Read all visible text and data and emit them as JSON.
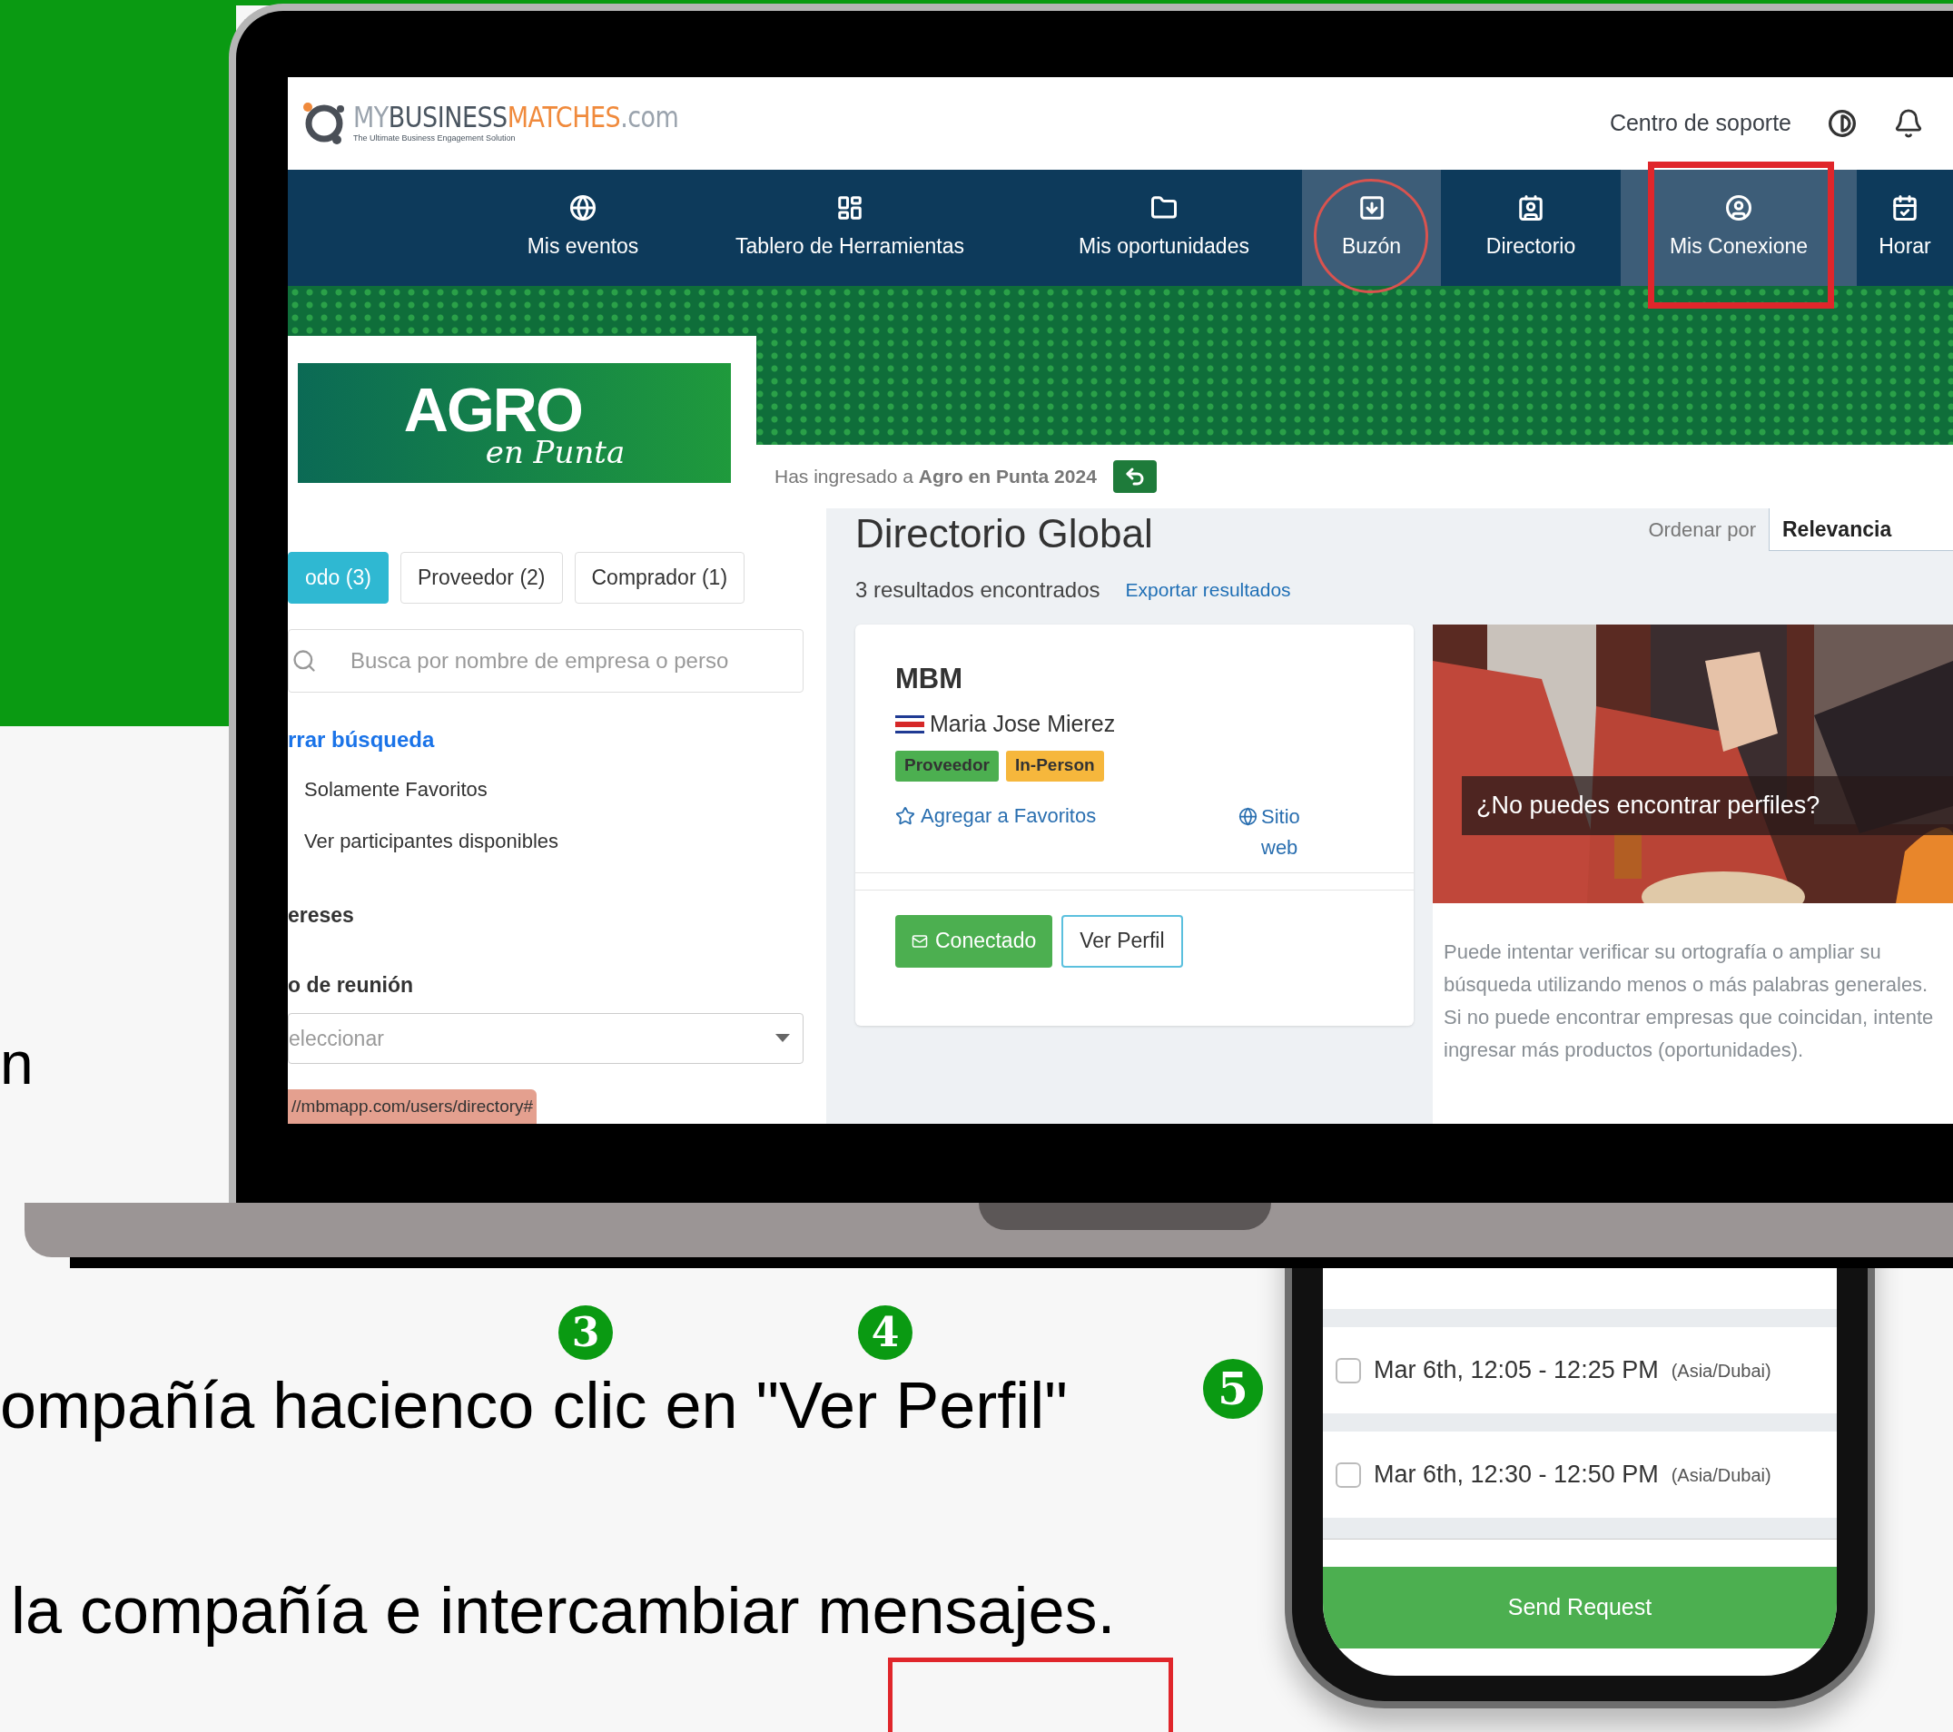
{
  "slide": {
    "fragment": "n",
    "steps": [
      {
        "number": "3"
      },
      {
        "number": "4"
      },
      {
        "number": "5"
      }
    ],
    "line_1": "ompañía hacienco clic en \"Ver Perfil\"",
    "line_2": "la compañía e intercambiar mensajes."
  },
  "app": {
    "logo": {
      "parts": [
        {
          "text": "MY",
          "color": "#9aa3ad"
        },
        {
          "text": "BUSINESS",
          "color": "#4a5560"
        },
        {
          "text": "MATCHES",
          "color": "#f08a3c"
        },
        {
          "text": ".com",
          "color": "#9aa3ad"
        }
      ],
      "tagline": "The Ultimate Business Engagement Solution"
    },
    "support_link": "Centro de soporte",
    "nav": [
      {
        "label": "Mis eventos",
        "highlighted": false
      },
      {
        "label": "Tablero de Herramientas",
        "highlighted": false
      },
      {
        "label": "Mis oportunidades",
        "highlighted": false
      },
      {
        "label": "Buzón",
        "highlighted": true
      },
      {
        "label": "Directorio",
        "highlighted": false
      },
      {
        "label": "Mis Conexione",
        "highlighted": true
      },
      {
        "label": "Horar",
        "highlighted": false
      }
    ],
    "event_logo": {
      "title": "AGRO",
      "subtitle": "en Punta"
    },
    "entered_notice": "Has ingresado a **Agro en Punta 2024**",
    "filters": {
      "tabs": [
        {
          "label": "odo (3)",
          "selected": true
        },
        {
          "label": "Proveedor (2)",
          "selected": false
        },
        {
          "label": "Comprador (1)",
          "selected": false
        }
      ],
      "search": {
        "placeholder": "Busca por nombre de empresa o perso"
      },
      "clear_link": "rrar búsqueda",
      "options": [
        "Solamente Favoritos",
        "Ver participantes disponibles"
      ],
      "section_1": "ereses",
      "section_2": "o de reunión",
      "select": {
        "placeholder": "eleccionar"
      }
    },
    "status_url": "//mbmapp.com/users/directory#",
    "directory": {
      "title": "Directorio Global",
      "sort_label": "Ordenar por",
      "sort_value": "Relevancia",
      "results": "3 resultados encontrados",
      "export": "Exportar resultados",
      "card": {
        "company": "MBM",
        "contact": "Maria Jose Mierez",
        "tags": [
          {
            "label": "Proveedor",
            "color": "#4caf50"
          },
          {
            "label": "In-Person",
            "color": "#f6b73c"
          }
        ],
        "favorite": "Agregar a Favoritos",
        "website": "Sitio web",
        "buttons": [
          {
            "label": "Conectado",
            "kind": "primary"
          },
          {
            "label": "Ver Perfil",
            "kind": "outline"
          }
        ]
      },
      "promo": {
        "kind": "picture",
        "caption": "¿No puedes encontrar perfiles?",
        "text": "Puede intentar verificar su ortografía o ampliar su búsqueda utilizando menos o más palabras generales. Si no puede encontrar empresas que coincidan, intente ingresar más productos (oportunidades)."
      }
    }
  },
  "phone": {
    "slots": [
      {
        "time": "Mar 6th, 12:05 - 12:25 PM",
        "zone": "(Asia/Dubai)",
        "checked": false
      },
      {
        "time": "Mar 6th, 12:30 - 12:50 PM",
        "zone": "(Asia/Dubai)",
        "checked": false
      }
    ],
    "button": "Send Request"
  }
}
